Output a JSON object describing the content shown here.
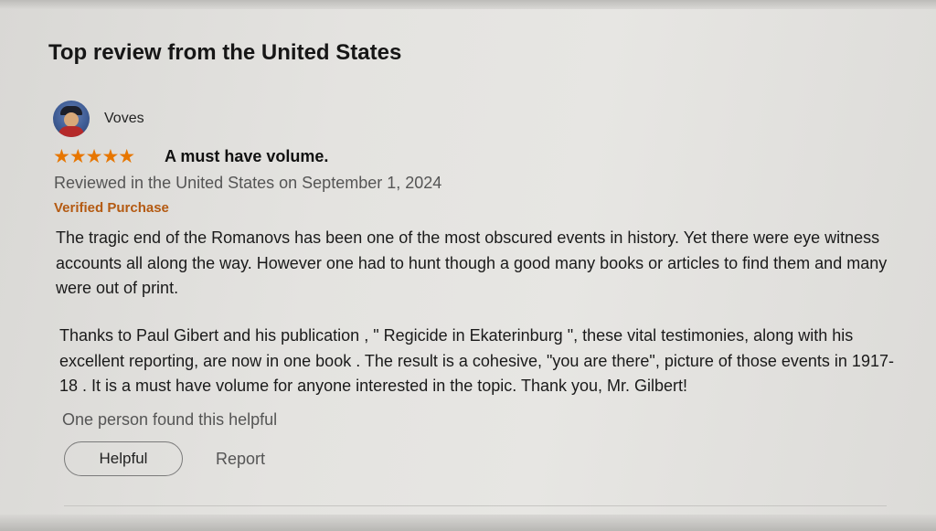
{
  "section": {
    "title": "Top review from the United States"
  },
  "review": {
    "author": "Voves",
    "rating": 5,
    "rating_max": 5,
    "stars_glyph": "★★★★★",
    "title": "A must have volume.",
    "date": "Reviewed in the United States on September 1, 2024",
    "badge": "Verified Purchase",
    "paragraphs": [
      "The tragic end of the Romanovs has been one of the most obscured events in history. Yet there were eye witness accounts all along the way. However one had to hunt though a good many books or articles to find them and many were out of print.",
      "Thanks to Paul Gibert and his publication , \" Regicide in Ekaterinburg \", these vital testimonies, along with his excellent reporting, are now in one book . The result is a cohesive, \"you are there\", picture of those events in 1917-18 . It is a must have volume for anyone interested in the topic. Thank you, Mr. Gilbert!"
    ],
    "helpful_count_text": "One person found this helpful"
  },
  "actions": {
    "helpful_label": "Helpful",
    "report_label": "Report"
  },
  "colors": {
    "star": "#e77600",
    "verified": "#b45a12"
  }
}
